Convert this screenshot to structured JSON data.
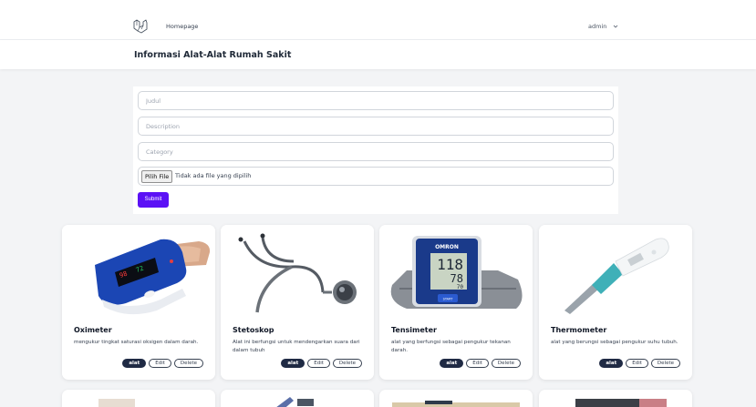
{
  "nav": {
    "link": "Homepage",
    "user": "admin",
    "chevron_icon": "chevron-down"
  },
  "header": {
    "title": "Informasi Alat-Alat Rumah Sakit"
  },
  "form": {
    "title_placeholder": "Judul",
    "description_placeholder": "Description",
    "category_placeholder": "Category",
    "file_button": "Pilih File",
    "file_status": "Tidak ada file yang dipilih",
    "submit_label": "Submit"
  },
  "cards": [
    {
      "title": "Oximeter",
      "description": "mengukur tingkat saturasi oksigen dalam darah.",
      "category": "alat",
      "edit": "Edit",
      "delete": "Delete"
    },
    {
      "title": "Stetoskop",
      "description": "Alat ini berfungsi untuk mendengarkan suara dari dalam tubuh",
      "category": "alat",
      "edit": "Edit",
      "delete": "Delete"
    },
    {
      "title": "Tensimeter",
      "description": "alat yang berfungsi sebagai pengukur tekanan darah.",
      "category": "alat",
      "edit": "Edit",
      "delete": "Delete"
    },
    {
      "title": "Thermometer",
      "description": "alat yang berungsi sebagai pengukur suhu tubuh.",
      "category": "alat",
      "edit": "Edit",
      "delete": "Delete"
    }
  ],
  "device_display": {
    "brand": "OMRON",
    "systolic": "118",
    "diastolic": "78",
    "pulse": "70",
    "start": "START"
  },
  "colors": {
    "accent": "#5b11f5",
    "tag": "#1f2a44",
    "background": "#f3f4f6"
  }
}
